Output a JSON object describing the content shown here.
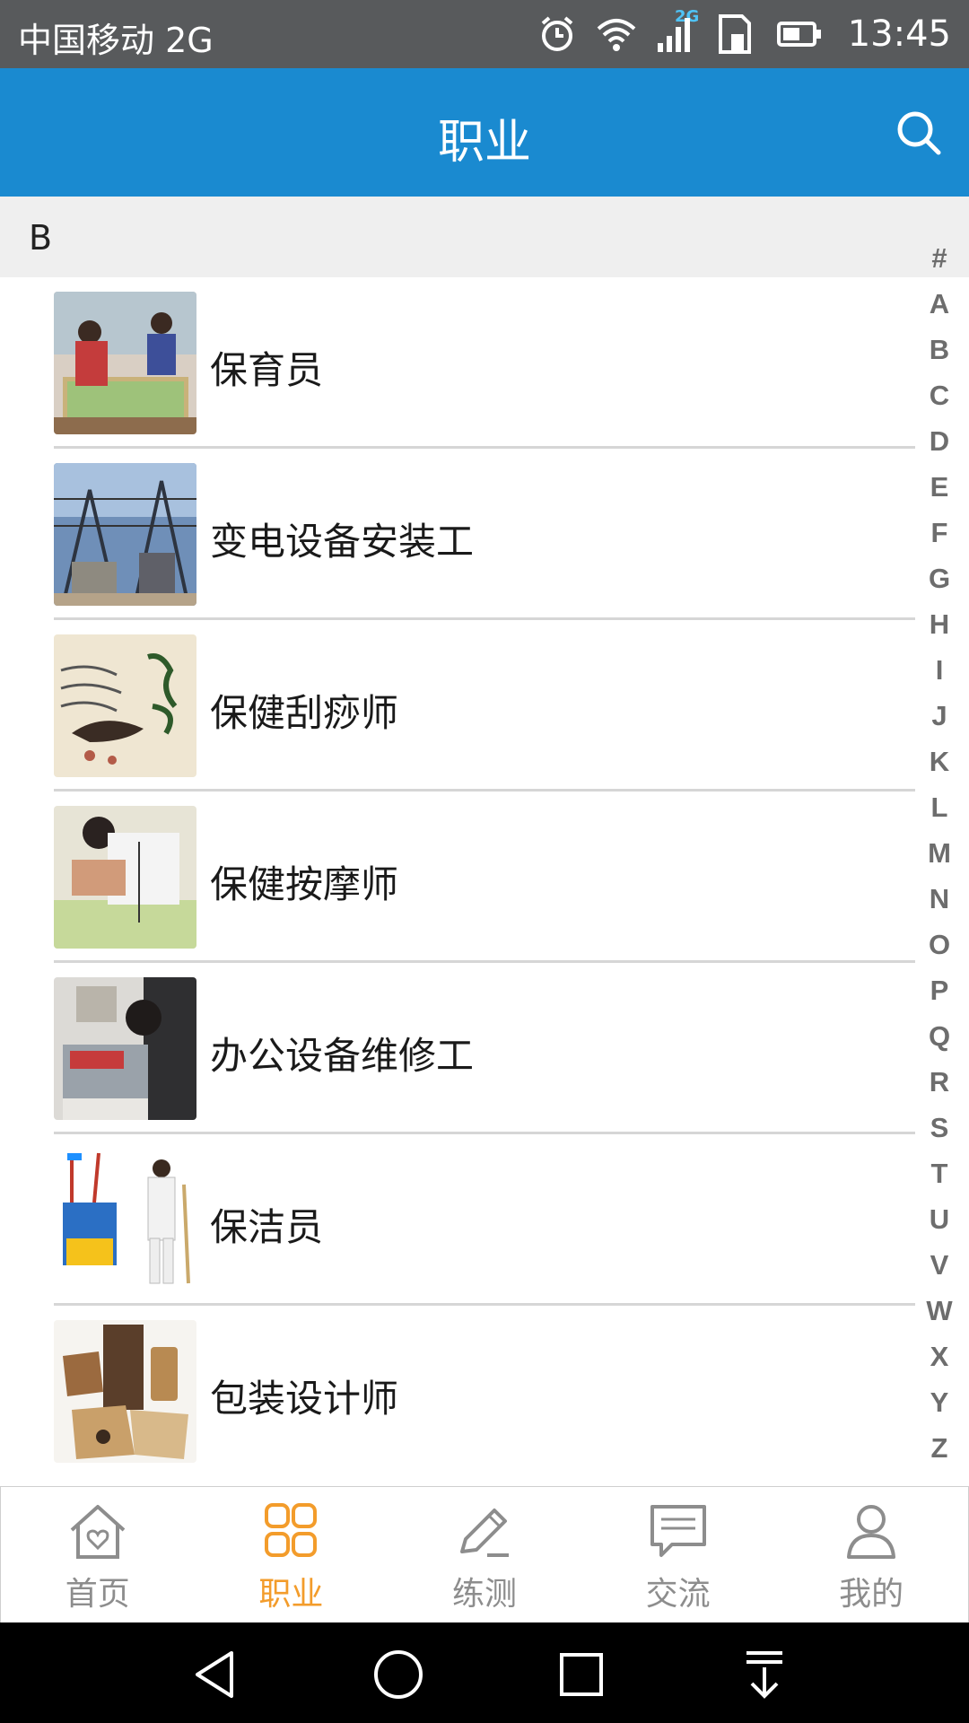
{
  "status_bar": {
    "carrier": "中国移动 2G",
    "network_badge": "2G",
    "time": "13:45"
  },
  "app_bar": {
    "title": "职业",
    "search_icon": "search-icon"
  },
  "section": {
    "letter": "B"
  },
  "occupations": [
    {
      "name": "保育员",
      "thumb": "childcare-photo"
    },
    {
      "name": "变电设备安装工",
      "thumb": "substation-photo"
    },
    {
      "name": "保健刮痧师",
      "thumb": "gua-sha-art"
    },
    {
      "name": "保健按摩师",
      "thumb": "massage-photo"
    },
    {
      "name": "办公设备维修工",
      "thumb": "office-repair-photo"
    },
    {
      "name": "保洁员",
      "thumb": "cleaner-photo"
    },
    {
      "name": "包装设计师",
      "thumb": "packaging-photo"
    }
  ],
  "index_letters": [
    "#",
    "A",
    "B",
    "C",
    "D",
    "E",
    "F",
    "G",
    "H",
    "I",
    "J",
    "K",
    "L",
    "M",
    "N",
    "O",
    "P",
    "Q",
    "R",
    "S",
    "T",
    "U",
    "V",
    "W",
    "X",
    "Y",
    "Z"
  ],
  "tabs": [
    {
      "label": "首页",
      "icon": "home-heart-icon",
      "active": false
    },
    {
      "label": "职业",
      "icon": "grid-icon",
      "active": true
    },
    {
      "label": "练测",
      "icon": "pencil-icon",
      "active": false
    },
    {
      "label": "交流",
      "icon": "chat-icon",
      "active": false
    },
    {
      "label": "我的",
      "icon": "person-icon",
      "active": false
    }
  ],
  "colors": {
    "app_bar": "#1a8ad0",
    "status_bar": "#585a5c",
    "active_tab": "#f39c2b",
    "inactive_tab": "#8d8d8d"
  }
}
